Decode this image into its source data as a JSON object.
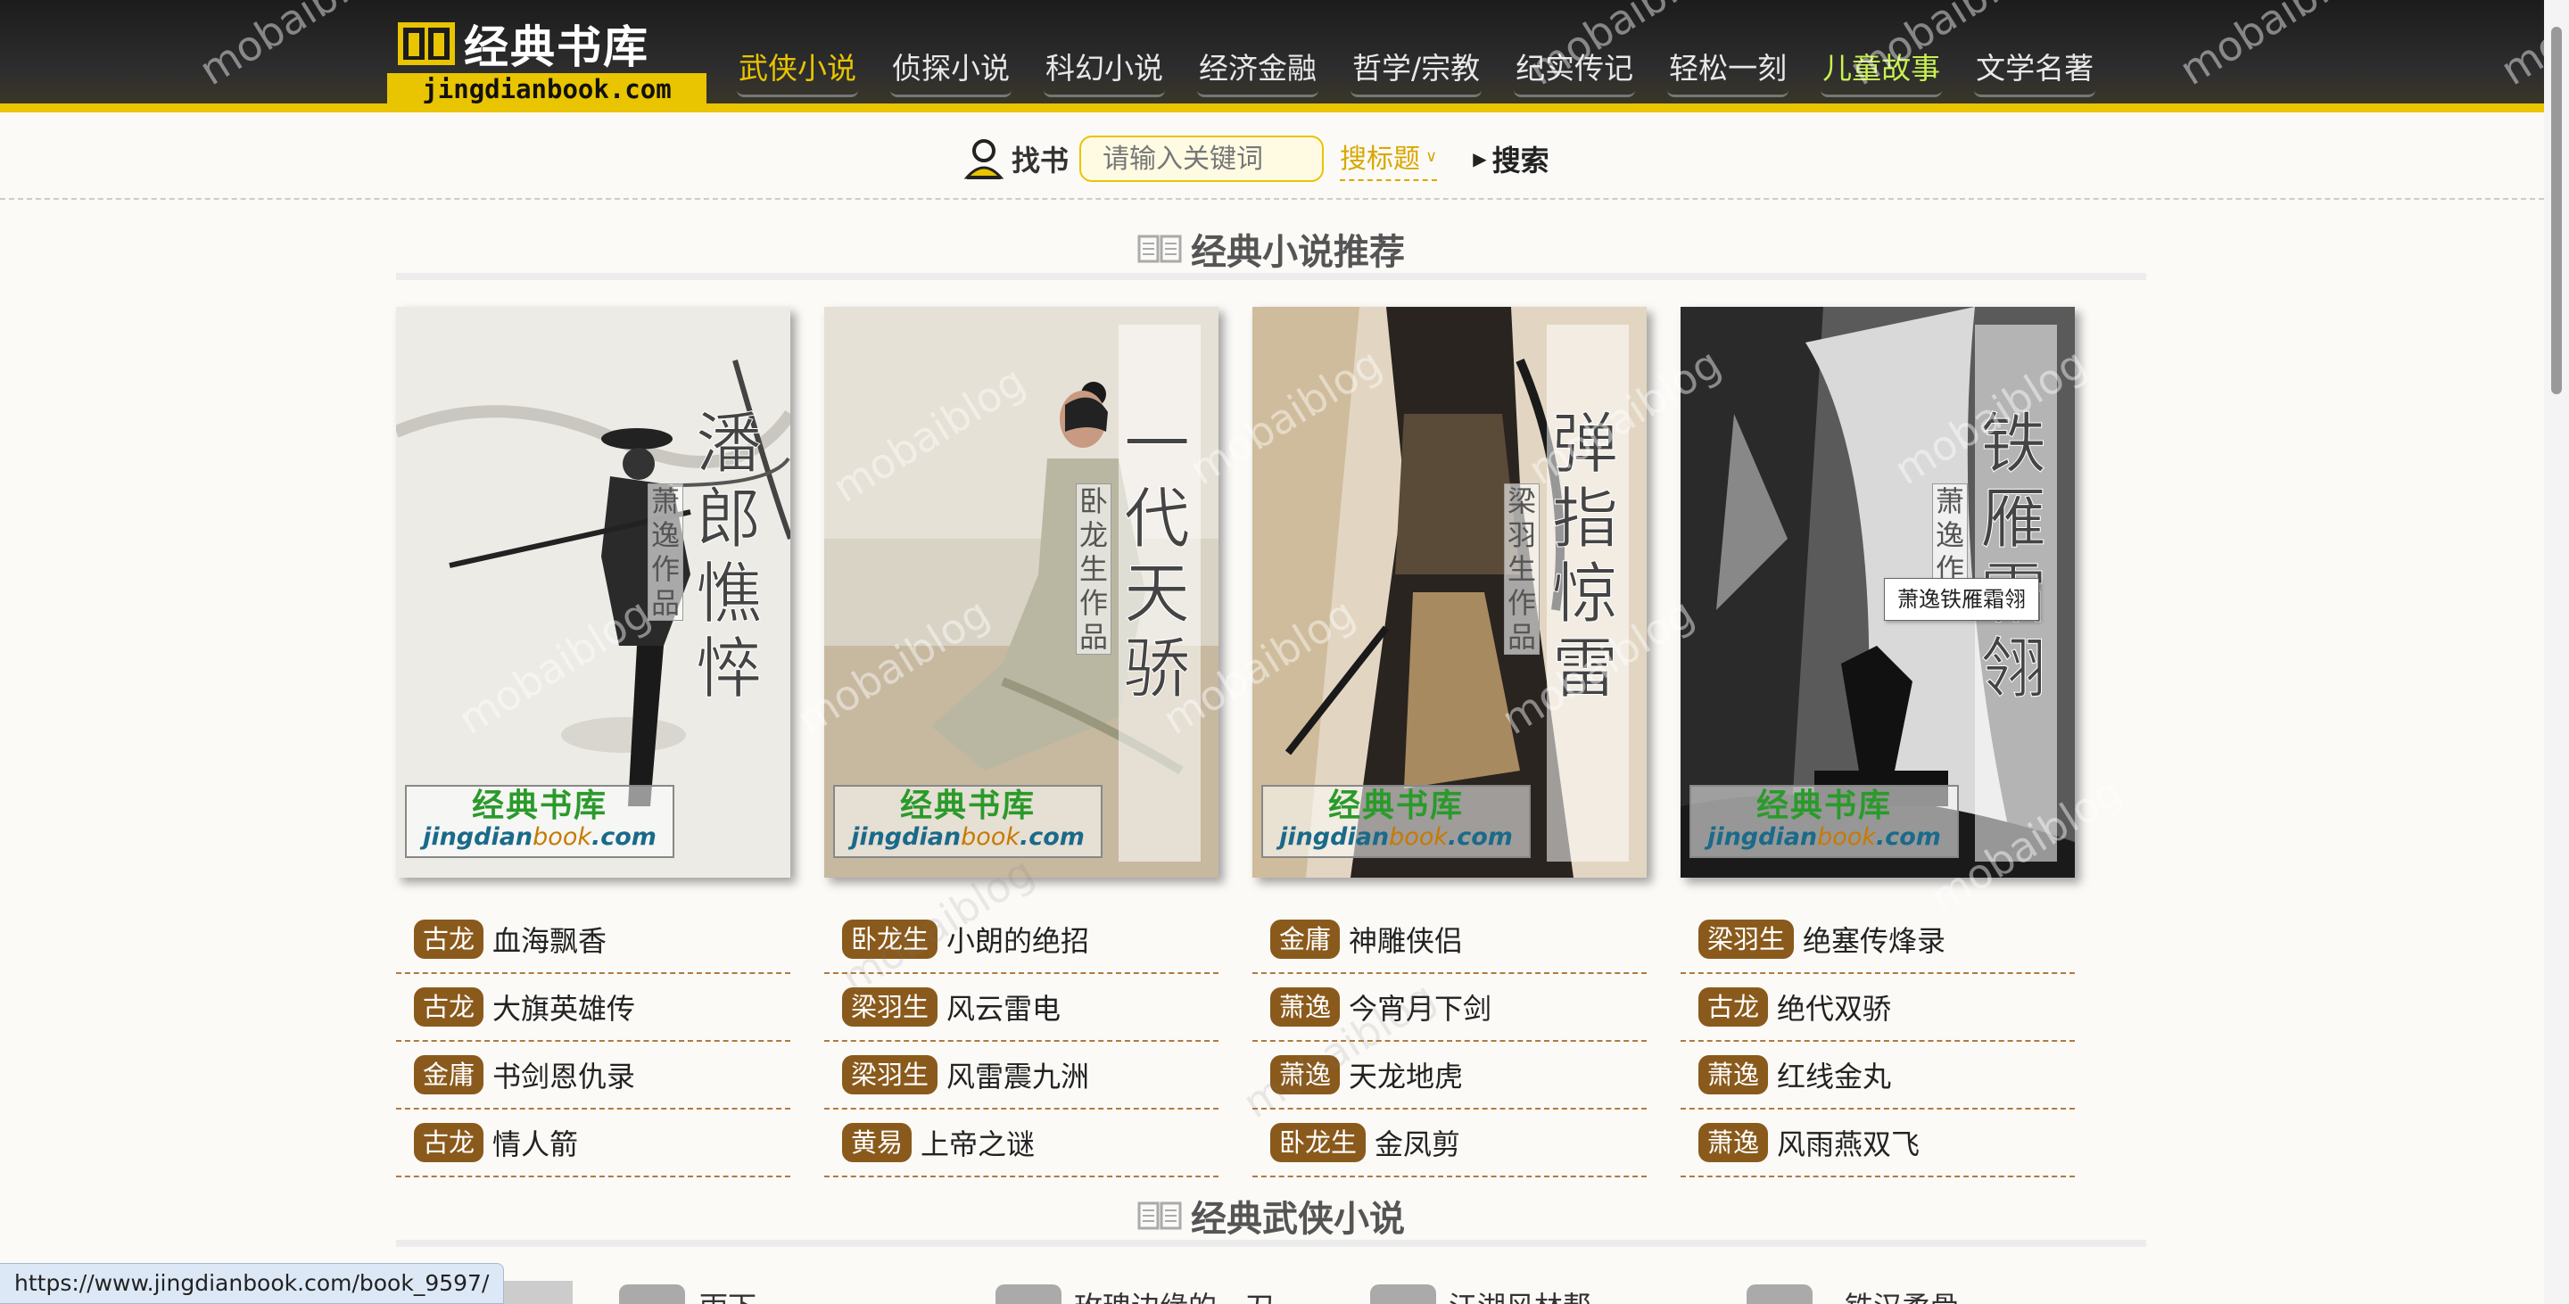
{
  "site": {
    "logo_title": "经典书库",
    "logo_domain": "jingdianbook.com",
    "accent": "#e9c400",
    "badge_color": "#8a5a1c"
  },
  "nav": [
    {
      "label": "武侠小说",
      "state": "active"
    },
    {
      "label": "侦探小说",
      "state": ""
    },
    {
      "label": "科幻小说",
      "state": ""
    },
    {
      "label": "经济金融",
      "state": ""
    },
    {
      "label": "哲学/宗教",
      "state": ""
    },
    {
      "label": "纪实传记",
      "state": ""
    },
    {
      "label": "轻松一刻",
      "state": ""
    },
    {
      "label": "儿童故事",
      "state": "hl"
    },
    {
      "label": "文学名著",
      "state": ""
    }
  ],
  "search": {
    "label": "找书",
    "placeholder": "请输入关键词",
    "type": "搜标题",
    "button": "搜索"
  },
  "sections": {
    "recommend": "经典小说推荐",
    "wuxia": "经典武侠小说"
  },
  "covers": [
    {
      "title": "潘郎憔悴",
      "author": "萧逸作品"
    },
    {
      "title": "一代天骄",
      "author": "卧龙生作品"
    },
    {
      "title": "弹指惊雷",
      "author": "梁羽生作品"
    },
    {
      "title": "铁雁霜翎",
      "author": "萧逸作品"
    }
  ],
  "cover_brand": {
    "cn": "经典书库",
    "en1": "jingdian",
    "en2": "book",
    "en3": ".com"
  },
  "tooltip": "萧逸铁雁霜翎",
  "lists": [
    [
      {
        "author": "古龙",
        "book": "血海飘香"
      },
      {
        "author": "古龙",
        "book": "大旗英雄传"
      },
      {
        "author": "金庸",
        "book": "书剑恩仇录"
      },
      {
        "author": "古龙",
        "book": "情人箭"
      }
    ],
    [
      {
        "author": "卧龙生",
        "book": "小朗的绝招"
      },
      {
        "author": "梁羽生",
        "book": "风云雷电"
      },
      {
        "author": "梁羽生",
        "book": "风雷震九洲"
      },
      {
        "author": "黄易",
        "book": "上帝之谜"
      }
    ],
    [
      {
        "author": "金庸",
        "book": "神雕侠侣"
      },
      {
        "author": "萧逸",
        "book": "今宵月下剑"
      },
      {
        "author": "萧逸",
        "book": "天龙地虎"
      },
      {
        "author": "卧龙生",
        "book": "金凤剪"
      }
    ],
    [
      {
        "author": "梁羽生",
        "book": "绝塞传烽录"
      },
      {
        "author": "古龙",
        "book": "绝代双骄"
      },
      {
        "author": "萧逸",
        "book": "红线金丸"
      },
      {
        "author": "萧逸",
        "book": "风雨燕双飞"
      }
    ]
  ],
  "peek": [
    "雨下",
    "玫瑰边缘的一刀",
    "江湖风林帮",
    "铁汉柔骨"
  ],
  "status_url": "https://www.jingdianbook.com/book_9597/",
  "watermark": "mobaiblog"
}
